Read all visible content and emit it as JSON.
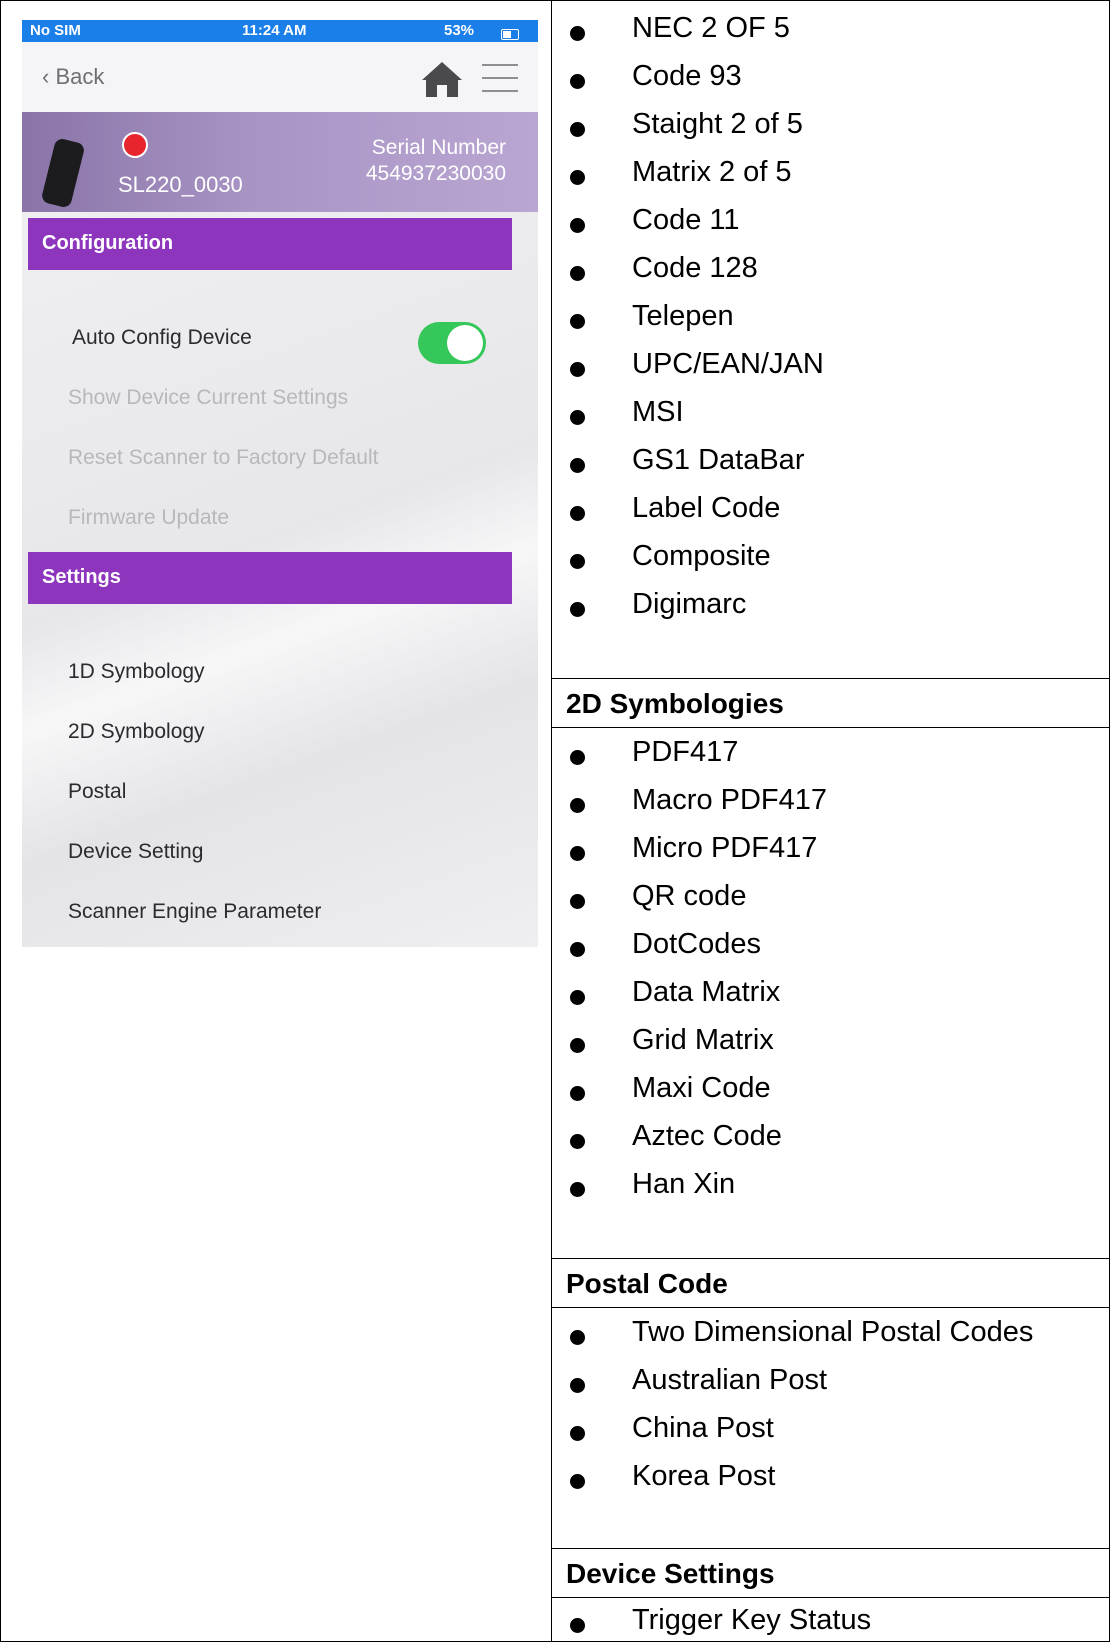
{
  "phone": {
    "status_bar": {
      "carrier": "No SIM",
      "time": "11:24 AM",
      "battery": "53%"
    },
    "nav": {
      "back_label": "Back"
    },
    "device": {
      "name": "SL220_0030",
      "serial_label": "Serial Number",
      "serial_value": "454937230030"
    },
    "configuration": {
      "header": "Configuration",
      "auto_config_label": "Auto Config Device",
      "auto_config_on": true,
      "items": [
        "Show Device Current Settings",
        "Reset Scanner to Factory Default",
        "Firmware Update"
      ]
    },
    "settings": {
      "header": "Settings",
      "items": [
        "1D Symbology",
        "2D Symbology",
        "Postal",
        "Device Setting",
        "Scanner Engine Parameter"
      ]
    },
    "colors": {
      "status_bar": "#1a7fe8",
      "section_header": "#8d36bd",
      "toggle_on": "#35c759",
      "status_dot": "#e8242c"
    }
  },
  "list": {
    "one_d_items": [
      "NEC 2 OF 5",
      "Code 93",
      "Staight 2 of 5",
      "Matrix 2 of 5",
      "Code 11",
      "Code 128",
      "Telepen",
      "UPC/EAN/JAN",
      "MSI",
      "GS1 DataBar",
      "Label Code",
      "Composite",
      "Digimarc"
    ],
    "two_d": {
      "title": "2D Symbologies",
      "items": [
        "PDF417",
        "Macro PDF417",
        "Micro PDF417",
        "QR code",
        "DotCodes",
        "Data Matrix",
        "Grid Matrix",
        "Maxi Code",
        "Aztec Code",
        "Han Xin"
      ]
    },
    "postal": {
      "title": "Postal Code",
      "items": [
        "Two Dimensional Postal Codes",
        "Australian Post",
        "China Post",
        "Korea Post"
      ]
    },
    "device_settings": {
      "title": "Device Settings",
      "items": [
        "Trigger Key Status"
      ]
    }
  }
}
